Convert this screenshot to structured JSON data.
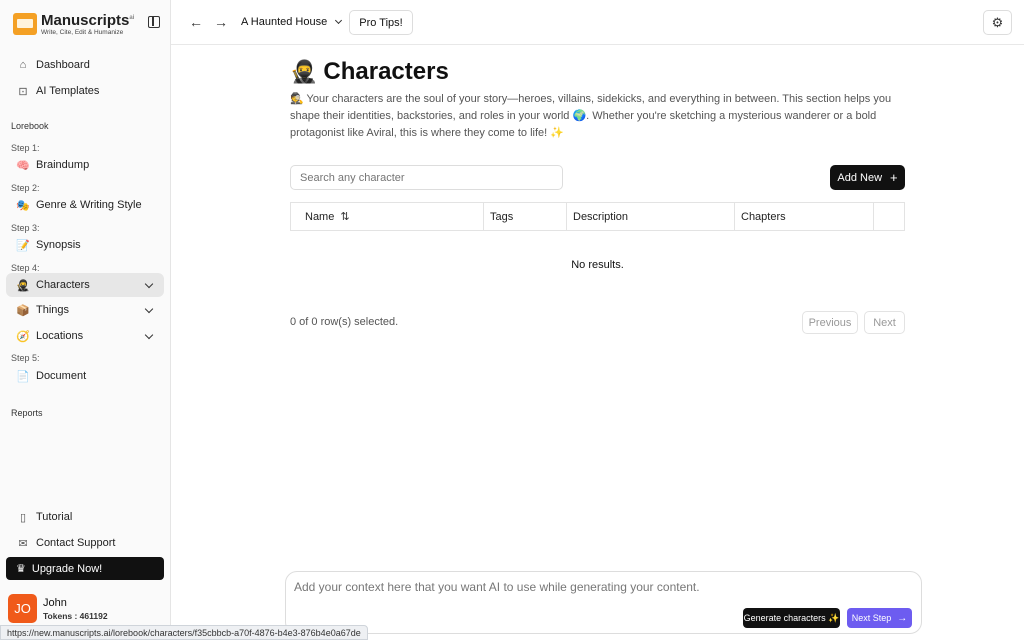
{
  "brand": {
    "name": "Manuscripts",
    "suffix": "ai",
    "tagline": "Write, Cite, Edit & Humanize"
  },
  "sidebar": {
    "top_items": [
      {
        "label": "Dashboard",
        "icon": "home-icon"
      },
      {
        "label": "AI Templates",
        "icon": "robot-icon"
      }
    ],
    "section_lorebook": "Lorebook",
    "steps": {
      "s1": "Step 1:",
      "s2": "Step 2:",
      "s3": "Step 3:",
      "s4": "Step 4:",
      "s5": "Step 5:"
    },
    "items": {
      "braindump": {
        "label": "Braindump",
        "emoji": "🧠"
      },
      "genre": {
        "label": "Genre & Writing Style",
        "emoji": "🎭"
      },
      "synopsis": {
        "label": "Synopsis",
        "emoji": "📝"
      },
      "characters": {
        "label": "Characters",
        "emoji": "🥷"
      },
      "things": {
        "label": "Things",
        "emoji": "📦"
      },
      "locations": {
        "label": "Locations",
        "emoji": "🧭"
      },
      "document": {
        "label": "Document",
        "emoji": "📄"
      }
    },
    "section_reports": "Reports",
    "bottom_items": {
      "tutorial": "Tutorial",
      "support": "Contact Support"
    },
    "upgrade": "Upgrade Now!",
    "user": {
      "initials": "JO",
      "name": "John",
      "tokens": "Tokens : 461192"
    }
  },
  "topbar": {
    "project": "A Haunted House",
    "pro_tips": "Pro Tips!"
  },
  "main": {
    "title_emoji": "🥷",
    "title": "Characters",
    "description": "🕵️ Your characters are the soul of your story—heroes, villains, sidekicks, and everything in between. This section helps you shape their identities, backstories, and roles in your world 🌍. Whether you're sketching a mysterious wanderer or a bold protagonist like Aviral, this is where they come to life! ✨",
    "search_placeholder": "Search any character",
    "add_new": "Add New",
    "table": {
      "name": "Name",
      "tags": "Tags",
      "description": "Description",
      "chapters": "Chapters"
    },
    "no_results": "No results.",
    "selected": "0 of 0 row(s) selected.",
    "prev": "Previous",
    "next": "Next"
  },
  "prompt": {
    "placeholder": "Add your context here that you want AI to use while generating your content.",
    "generate": "Generate characters ✨",
    "next_step": "Next Step"
  },
  "status_url": "https://new.manuscripts.ai/lorebook/characters/f35cbbcb-a70f-4876-b4e3-876b4e0a67de"
}
